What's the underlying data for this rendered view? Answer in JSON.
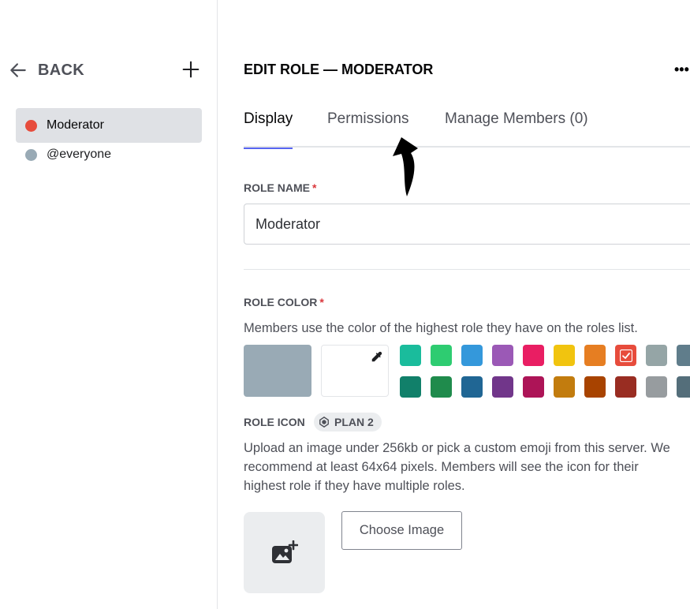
{
  "sidebar": {
    "back_label": "BACK",
    "add_icon": "plus-icon",
    "back_icon": "arrow-left-icon",
    "roles": [
      {
        "name": "Moderator",
        "color": "#e74c3c",
        "selected": true
      },
      {
        "name": "@everyone",
        "color": "#99aab5",
        "selected": false
      }
    ]
  },
  "header": {
    "title": "EDIT ROLE — MODERATOR",
    "more_label": "•••"
  },
  "tabs": [
    {
      "label": "Display",
      "selected": true
    },
    {
      "label": "Permissions",
      "selected": false
    },
    {
      "label": "Manage Members (0)",
      "selected": false
    }
  ],
  "role_name": {
    "label": "ROLE NAME",
    "required_mark": "*",
    "value": "Moderator"
  },
  "role_color": {
    "label": "ROLE COLOR",
    "required_mark": "*",
    "description": "Members use the color of the highest role they have on the roles list.",
    "default_color": "#99aab5",
    "selected_color": "#e74c3c",
    "top_row": [
      "#1abc9c",
      "#2ecc71",
      "#3498db",
      "#9b59b6",
      "#e91e63",
      "#f1c40f",
      "#e67e22",
      "#e74c3c",
      "#95a5a6",
      "#607d8b"
    ],
    "bottom_row": [
      "#11806a",
      "#1f8b4c",
      "#206694",
      "#71368a",
      "#ad1457",
      "#c27c0e",
      "#a84300",
      "#992d22",
      "#979c9f",
      "#546e7a"
    ]
  },
  "role_icon": {
    "label": "ROLE ICON",
    "badge": "PLAN 2",
    "description_lines": [
      "Upload an image under 256kb or pick a custom emoji from this server. We",
      "recommend at least 64x64 pixels. Members will see the icon for their",
      "highest role if they have multiple roles."
    ],
    "choose_label": "Choose Image",
    "upload_icon": "image-add-icon"
  },
  "colors": {
    "accent": "#5865f2",
    "required": "#da373c"
  }
}
